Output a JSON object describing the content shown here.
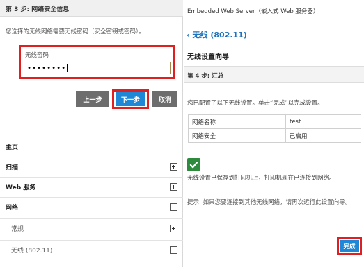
{
  "left": {
    "step_header": "第 3 步: 网络安全信息",
    "description": "您选择的无线网络需要无线密码（安全密钥或密码）。",
    "password_label": "无线密码",
    "password_value": "••••••••",
    "buttons": {
      "prev": "上一步",
      "next": "下一步",
      "cancel": "取消"
    },
    "nav": [
      {
        "label": "主页"
      },
      {
        "label": "扫描",
        "icon": "plus"
      },
      {
        "label": "Web 服务",
        "icon": "plus"
      },
      {
        "label": "网络",
        "icon": "minus"
      },
      {
        "label": "常规",
        "icon": "plus"
      },
      {
        "label": "无线 (802.11)",
        "icon": "minus"
      }
    ]
  },
  "right": {
    "server_title": "Embedded Web Server（嵌入式 Web 服务器）",
    "back_label": "无线 (802.11)",
    "wizard_title": "无线设置向导",
    "step_header": "第 4 步: 汇总",
    "confirm_text": "您已配置了以下无线设置。单击“完成”以完成设置。",
    "table": [
      {
        "name": "网络名称",
        "value": "test"
      },
      {
        "name": "网络安全",
        "value": "已启用"
      }
    ],
    "saved_text": "无线设置已保存到打印机上，打印机现在已连接到网络。",
    "hint_text": "提示: 如果您要连接到其他无线网络，请再次运行此设置向导。",
    "finish_label": "完成"
  },
  "colors": {
    "accent_blue": "#1e88d6",
    "highlight_red": "#e02020",
    "success_green": "#2e8a3d",
    "button_gray": "#6d6d6d"
  }
}
